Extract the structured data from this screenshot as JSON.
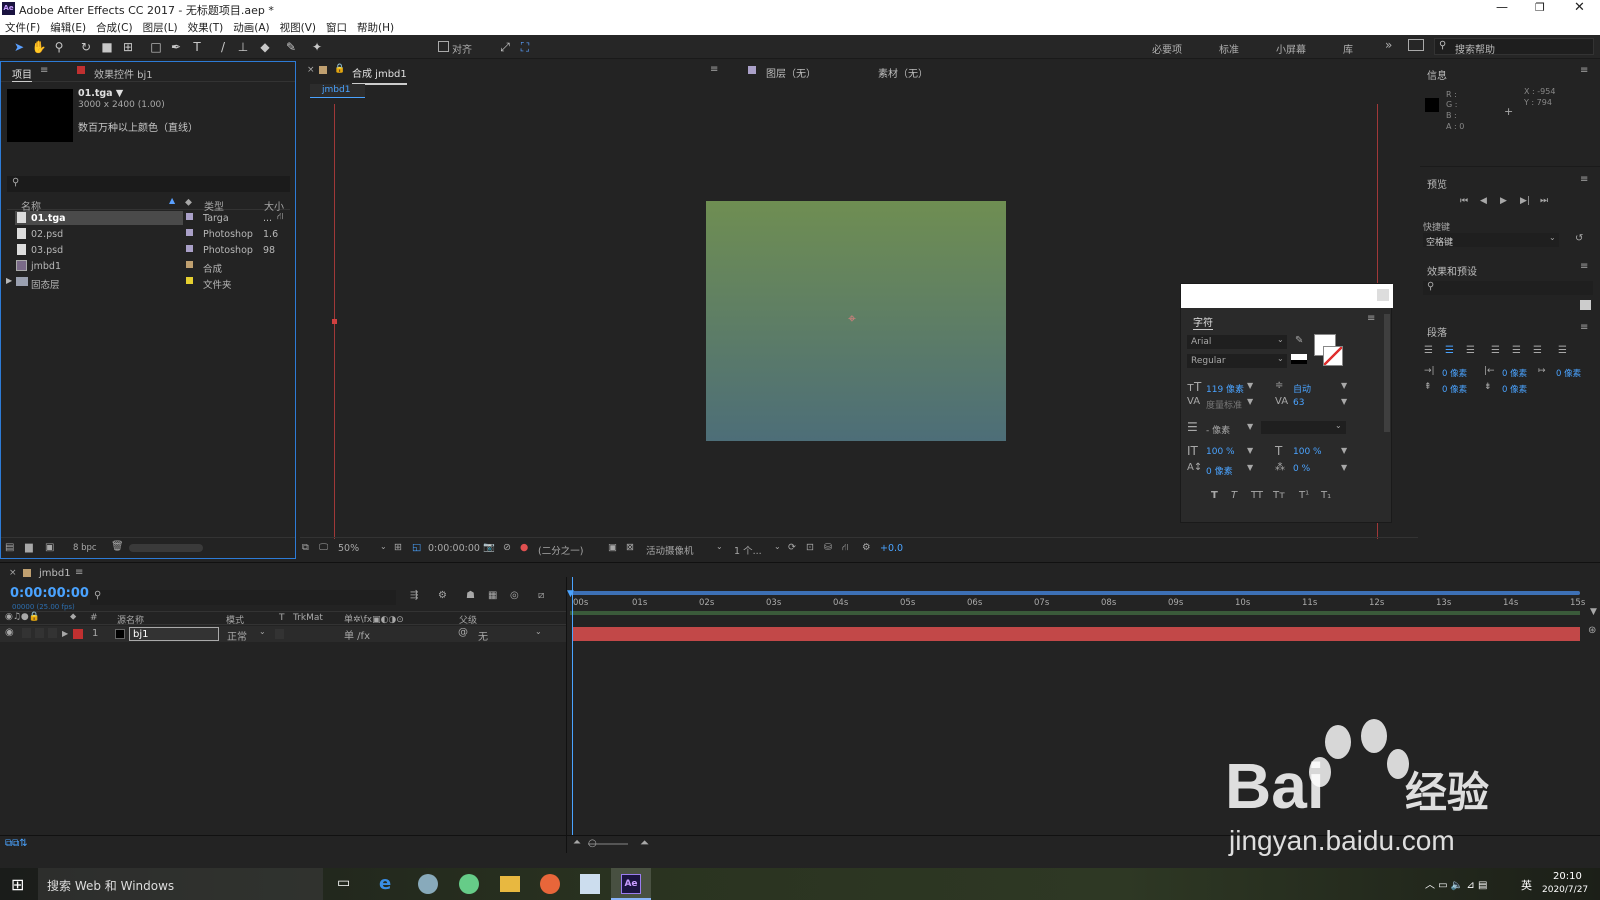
{
  "app": {
    "title": "Adobe After Effects CC 2017 - 无标题项目.aep *",
    "logo": "Ae"
  },
  "menu": [
    "文件(F)",
    "编辑(E)",
    "合成(C)",
    "图层(L)",
    "效果(T)",
    "动画(A)",
    "视图(V)",
    "窗口",
    "帮助(H)"
  ],
  "toolbar": {
    "snap_label": "对齐",
    "workspaces": [
      "必要项",
      "标准",
      "小屏幕",
      "库"
    ],
    "search_placeholder": "搜索帮助"
  },
  "project": {
    "tab": "项目",
    "effects_tab": "效果控件 bj1",
    "selected_file": "01.tga ▼",
    "dimensions": "3000 x 2400 (1.00)",
    "color_info": "数百万种以上颜色（直线）",
    "columns": [
      "名称",
      "类型",
      "大小"
    ],
    "items": [
      {
        "name": "01.tga",
        "type": "Targa",
        "size": "...",
        "color": "#aaa0c8"
      },
      {
        "name": "02.psd",
        "type": "Photoshop",
        "size": "1.6",
        "color": "#aaa0c8"
      },
      {
        "name": "03.psd",
        "type": "Photoshop",
        "size": "98",
        "color": "#aaa0c8"
      },
      {
        "name": "jmbd1",
        "type": "合成",
        "size": "",
        "color": "#c0a070"
      },
      {
        "name": "固态层",
        "type": "文件夹",
        "size": "",
        "color": "#e6d030"
      }
    ],
    "bpc": "8 bpc"
  },
  "comp": {
    "tab": "合成 jmbd1",
    "layer_tab": "图层（无）",
    "footage_tab": "素材（无）",
    "breadcrumb": "jmbd1",
    "zoom": "50%",
    "time": "0:00:00:00",
    "resolution": "(二分之一)",
    "camera": "活动摄像机",
    "views": "1 个...",
    "exposure": "+0.0",
    "gradient_top": "#6f8e52",
    "gradient_bottom": "#4d6e78"
  },
  "info": {
    "title": "信息",
    "rgb": [
      "R :",
      "G :",
      "B :",
      "A : 0"
    ],
    "x": "X : -954",
    "y": "Y : 794"
  },
  "preview": {
    "title": "预览",
    "shortcut_label": "快捷键",
    "shortcut_value": "空格键"
  },
  "effects_presets": {
    "title": "效果和预设"
  },
  "paragraph": {
    "title": "段落",
    "fields": [
      "0 像素",
      "0 像素",
      "0 像素",
      "0 像素",
      "0 像素"
    ]
  },
  "character": {
    "title": "字符",
    "font": "Arial",
    "style": "Regular",
    "size": "119 像素",
    "leading": "自动",
    "kerning": "度量标准",
    "tracking": "63",
    "stroke": "- 像素",
    "vscale": "100 %",
    "hscale": "100 %",
    "baseline": "0 像素",
    "tsume": "0 %",
    "caps": [
      "T",
      "T",
      "TT",
      "Tт",
      "T¹",
      "T₁"
    ]
  },
  "timeline": {
    "tab": "jmbd1",
    "timecode": "0:00:00:00",
    "fps": "00000 (25.00 fps)",
    "columns": [
      "源名称",
      "模式",
      "T",
      "TrkMat",
      "父级"
    ],
    "layer": {
      "num": "1",
      "name": "bj1",
      "mode": "正常",
      "parent": "无",
      "color": "#c03030"
    },
    "ticks": [
      "00s",
      "01s",
      "02s",
      "03s",
      "04s",
      "05s",
      "06s",
      "07s",
      "08s",
      "09s",
      "10s",
      "11s",
      "12s",
      "13s",
      "14s",
      "15s"
    ]
  },
  "taskbar": {
    "search": "搜索 Web 和 Windows",
    "time": "20:10",
    "date": "2020/7/27",
    "lang": "英"
  },
  "watermark": {
    "brand": "Bai",
    "cn": "经验",
    "url": "jingyan.baidu.com"
  }
}
